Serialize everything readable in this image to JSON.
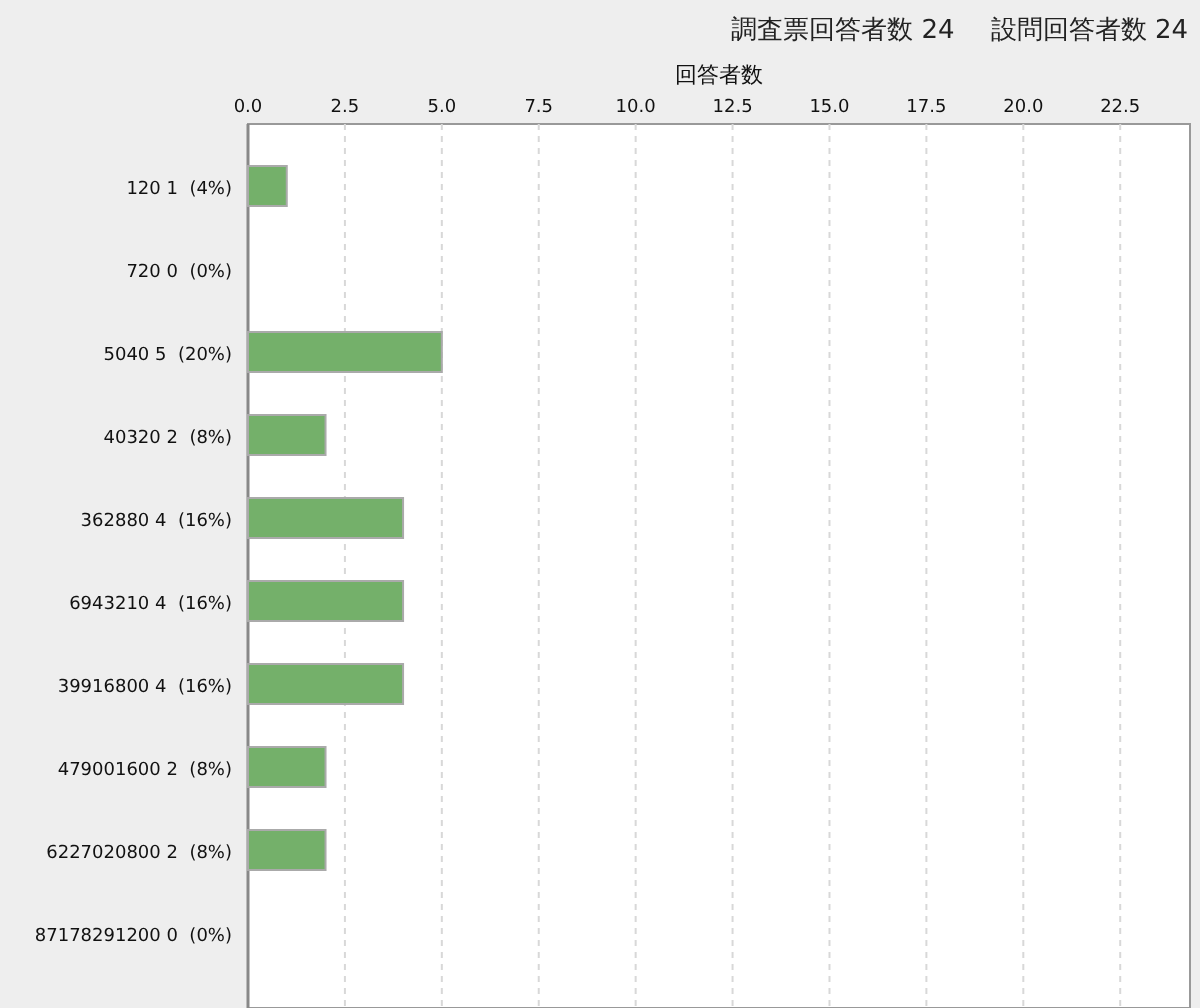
{
  "header": {
    "questionnaire_respondents": "調査票回答者数 24",
    "question_respondents": "設問回答者数 24"
  },
  "chart_data": {
    "type": "bar",
    "orientation": "horizontal",
    "xlabel": "回答者数",
    "categories": [
      "120 1  (4%)",
      "720 0  (0%)",
      "5040 5  (20%)",
      "40320 2  (8%)",
      "362880 4  (16%)",
      "6943210 4  (16%)",
      "39916800 4  (16%)",
      "479001600 2  (8%)",
      "6227020800 2  (8%)",
      "87178291200 0  (0%)"
    ],
    "series": [
      {
        "color": "#74b06a",
        "values": [
          1,
          0,
          5,
          2,
          4,
          4,
          4,
          2,
          2,
          0
        ]
      }
    ],
    "grid": true,
    "xlim": [
      0,
      24.3
    ],
    "xticks": [
      {
        "value": 0,
        "label": "0.0"
      },
      {
        "value": 2.5,
        "label": "2.5"
      },
      {
        "value": 5,
        "label": "5.0"
      },
      {
        "value": 7.5,
        "label": "7.5"
      },
      {
        "value": 10,
        "label": "10.0"
      },
      {
        "value": 12.5,
        "label": "12.5"
      },
      {
        "value": 15,
        "label": "15.0"
      },
      {
        "value": 17.5,
        "label": "17.5"
      },
      {
        "value": 20,
        "label": "20.0"
      },
      {
        "value": 22.5,
        "label": "22.5"
      }
    ]
  }
}
